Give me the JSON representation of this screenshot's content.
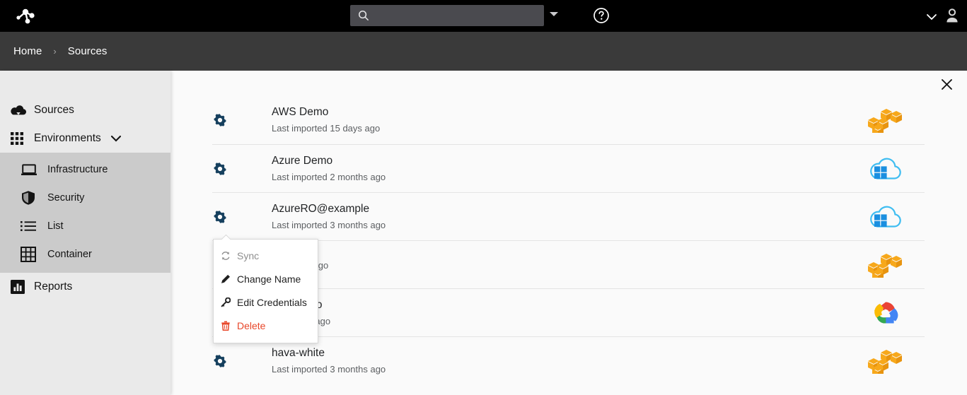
{
  "topbar": {
    "logo_name": "network-nodes-logo",
    "search": {
      "value": "",
      "placeholder": ""
    },
    "search_icon": "search-icon",
    "search_caret_icon": "caret-down-icon",
    "help_icon": "help-circle-icon",
    "user_caret_icon": "chevron-down-icon",
    "avatar_icon": "user-avatar-icon",
    "bg": "#000000"
  },
  "breadcrumb": {
    "home": "Home",
    "separator": "›",
    "current": "Sources",
    "bg": "#3a3a3a"
  },
  "sidebar": {
    "close_icon": "close-icon",
    "bg": "#eaeaea",
    "group_bg": "#cbcbcb",
    "top_items": [
      {
        "label": "Sources",
        "icon": "cloud-download-icon"
      },
      {
        "label": "Environments",
        "icon": "grid-dots-icon",
        "caret": "chevron-down-icon",
        "expanded": true
      }
    ],
    "sub_items": [
      {
        "label": "Infrastructure",
        "icon": "laptop-icon"
      },
      {
        "label": "Security",
        "icon": "shield-icon"
      },
      {
        "label": "List",
        "icon": "list-icon"
      },
      {
        "label": "Container",
        "icon": "table-grid-icon"
      }
    ],
    "bottom_items": [
      {
        "label": "Reports",
        "icon": "bar-chart-icon"
      }
    ]
  },
  "sources": {
    "gear_icon": "gear-icon",
    "gear_color": "#16405e",
    "rows": [
      {
        "title": "AWS Demo",
        "subtitle": "Last imported 15 days ago",
        "cloud": "aws-icon"
      },
      {
        "title": "Azure Demo",
        "subtitle": "Last imported 2 months ago",
        "cloud": "azure-icon"
      },
      {
        "title": "AzureRO@example",
        "subtitle": "Last imported 3 months ago",
        "cloud": "azure-icon"
      },
      {
        "title": "",
        "subtitle": "d an hour ago",
        "cloud": "aws-icon"
      },
      {
        "title": "oud Demo",
        "subtitle": "d a month ago",
        "cloud": "gcp-icon"
      },
      {
        "title": "hava-white",
        "subtitle": "Last imported 3 months ago",
        "cloud": "aws-icon"
      }
    ]
  },
  "context_menu": {
    "items": [
      {
        "label": "Sync",
        "icon": "refresh-icon",
        "state": "disabled"
      },
      {
        "label": "Change Name",
        "icon": "pencil-icon",
        "state": "enabled"
      },
      {
        "label": "Edit Credentials",
        "icon": "key-icon",
        "state": "enabled"
      },
      {
        "label": "Delete",
        "icon": "trash-icon",
        "state": "danger"
      }
    ],
    "danger_color": "#e8472a"
  }
}
